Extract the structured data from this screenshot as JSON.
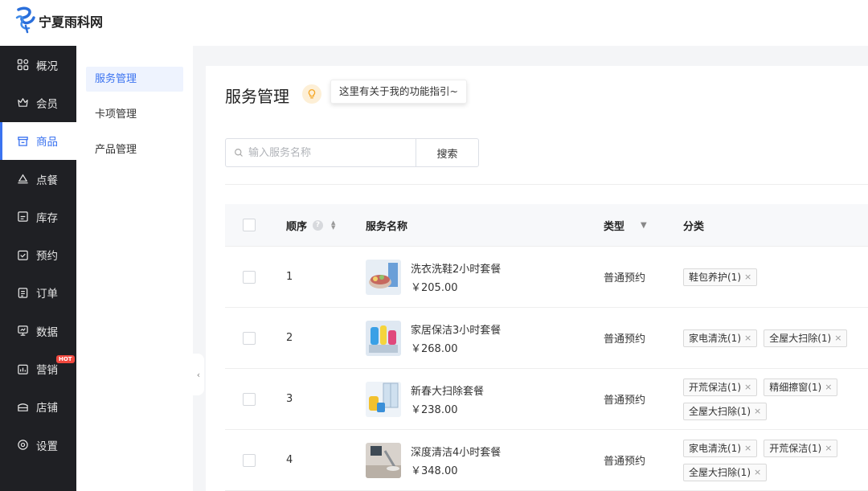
{
  "brand": {
    "name": "宁夏雨科网"
  },
  "sidebar": {
    "items": [
      {
        "label": "概况",
        "icon": "grid-icon"
      },
      {
        "label": "会员",
        "icon": "crown-icon"
      },
      {
        "label": "商品",
        "icon": "store-icon",
        "active": true
      },
      {
        "label": "点餐",
        "icon": "dish-icon"
      },
      {
        "label": "库存",
        "icon": "inventory-icon"
      },
      {
        "label": "预约",
        "icon": "calendar-check-icon"
      },
      {
        "label": "订单",
        "icon": "order-icon"
      },
      {
        "label": "数据",
        "icon": "monitor-icon"
      },
      {
        "label": "营销",
        "icon": "marketing-icon",
        "badge": "HOT"
      },
      {
        "label": "店铺",
        "icon": "shop-icon"
      },
      {
        "label": "设置",
        "icon": "settings-icon"
      }
    ]
  },
  "subnav": {
    "items": [
      {
        "label": "服务管理",
        "active": true
      },
      {
        "label": "卡项管理"
      },
      {
        "label": "产品管理"
      }
    ]
  },
  "main": {
    "title": "服务管理",
    "guide_text": "这里有关于我的功能指引~",
    "search": {
      "placeholder": "输入服务名称",
      "button": "搜索"
    }
  },
  "table": {
    "headers": {
      "order": "顺序",
      "name": "服务名称",
      "type": "类型",
      "category": "分类"
    },
    "rows": [
      {
        "order": "1",
        "name": "洗衣洗鞋2小时套餐",
        "price": "￥205.00",
        "type": "普通预约",
        "tags": [
          "鞋包养护(1)"
        ]
      },
      {
        "order": "2",
        "name": "家居保洁3小时套餐",
        "price": "￥268.00",
        "type": "普通预约",
        "tags": [
          "家电清洗(1)",
          "全屋大扫除(1)"
        ]
      },
      {
        "order": "3",
        "name": "新春大扫除套餐",
        "price": "￥238.00",
        "type": "普通预约",
        "tags": [
          "开荒保洁(1)",
          "精细擦窗(1)",
          "全屋大扫除(1)"
        ]
      },
      {
        "order": "4",
        "name": "深度清洁4小时套餐",
        "price": "￥348.00",
        "type": "普通预约",
        "tags": [
          "家电清洗(1)",
          "开荒保洁(1)",
          "全屋大扫除(1)"
        ]
      }
    ]
  },
  "colors": {
    "accent": "#3b73f0",
    "sidebar_bg": "#1f2024",
    "hot_badge": "#f0483e"
  }
}
